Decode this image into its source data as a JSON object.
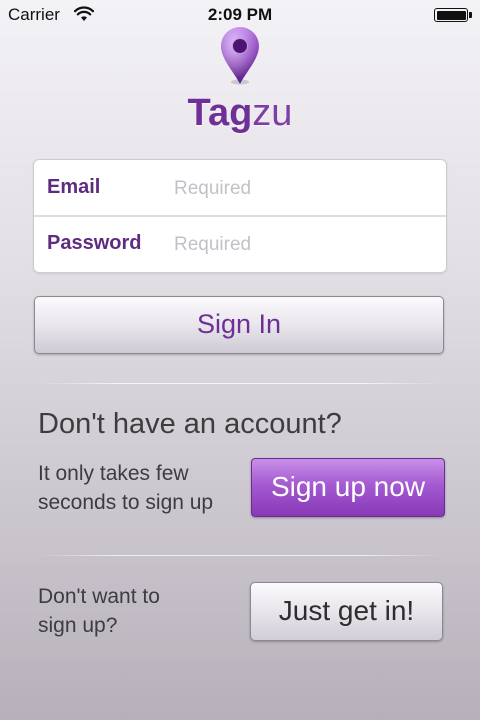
{
  "status_bar": {
    "carrier": "Carrier",
    "time": "2:09 PM",
    "icons": [
      "wifi-icon",
      "battery-icon"
    ]
  },
  "brand": {
    "name_bold": "Tag",
    "name_light": "zu",
    "icon": "location-pin-icon",
    "accent_color": "#7d3fa5"
  },
  "form": {
    "email_label": "Email",
    "email_placeholder": "Required",
    "email_value": "",
    "password_label": "Password",
    "password_placeholder": "Required",
    "password_value": ""
  },
  "sign_in_label": "Sign In",
  "signup_section": {
    "heading": "Don't have an account?",
    "line1": "It only takes few",
    "line2": "seconds to sign up",
    "button_label": "Sign up now"
  },
  "guest_section": {
    "line1": "Don't want to",
    "line2": "sign up?",
    "button_label": "Just get in!"
  }
}
